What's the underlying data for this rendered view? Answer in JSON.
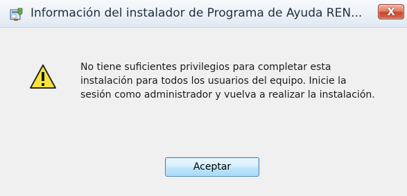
{
  "window": {
    "title": "Información del instalador de Programa de Ayuda REN...",
    "title_icon": "installer-icon",
    "close_label": "X"
  },
  "dialog": {
    "icon": "warning-icon",
    "message": "No tiene suficientes privilegios para completar esta instalación para todos los usuarios del equipo. Inicie la sesión como administrador y vuelva a realizar la instalación.",
    "ok_label": "Aceptar"
  },
  "colors": {
    "titlebar": "#eef3f8",
    "close_button": "#c9462c",
    "background": "#f0f0f0",
    "button_border": "#3c7fb1",
    "warning_fill": "#f6e43a"
  }
}
